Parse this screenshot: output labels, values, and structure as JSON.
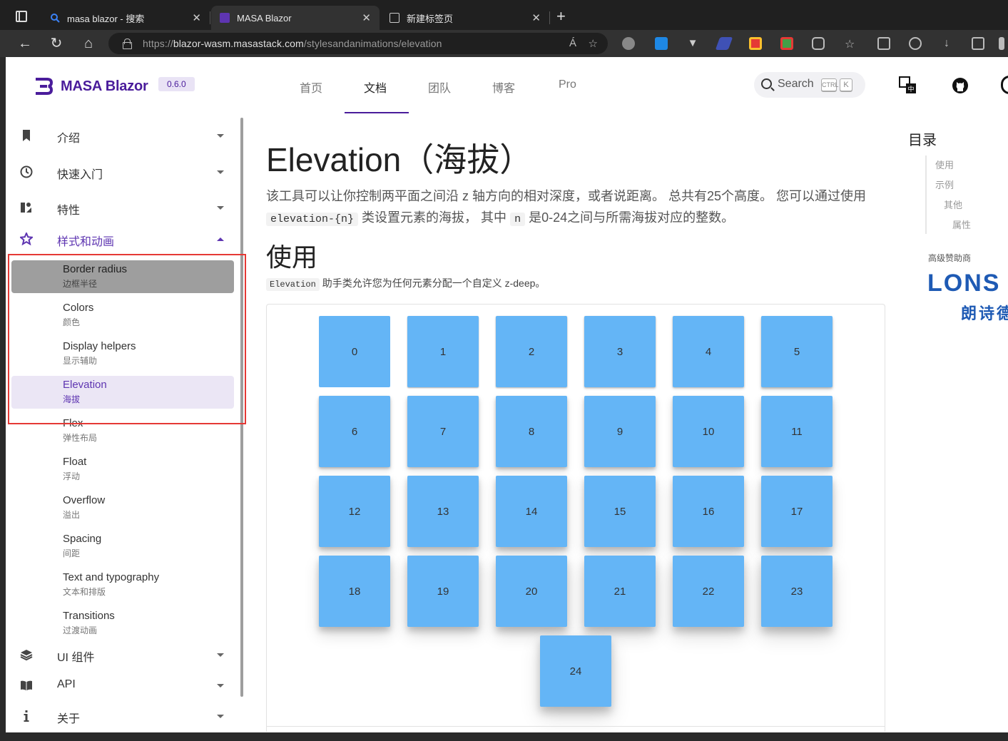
{
  "browser": {
    "tabs": [
      {
        "title": "masa blazor - 搜索",
        "active": false
      },
      {
        "title": "MASA Blazor",
        "active": true
      },
      {
        "title": "新建标签页",
        "active": false
      }
    ],
    "new_tab": "+",
    "url_prefix": "https://",
    "url_host": "blazor-wasm.masastack.com",
    "url_path": "/stylesandanimations/elevation",
    "read_aloud": "Á"
  },
  "header": {
    "brand": "MASA Blazor",
    "version": "0.6.0",
    "nav": [
      "首页",
      "文档",
      "团队",
      "博客",
      "Pro"
    ],
    "active_nav": "文档",
    "search_label": "Search",
    "kbd_ctrl": "CTRL",
    "kbd_k": "K"
  },
  "sidebar": {
    "groups_top": [
      {
        "label": "介绍",
        "icon": "bookmark-icon"
      },
      {
        "label": "快速入门",
        "icon": "clock-icon"
      },
      {
        "label": "特性",
        "icon": "features-icon"
      },
      {
        "label": "样式和动画",
        "icon": "star-icon",
        "open": true
      }
    ],
    "items": [
      {
        "title": "Border radius",
        "subtitle": "边框半径",
        "state": "hover"
      },
      {
        "title": "Colors",
        "subtitle": "颜色",
        "state": ""
      },
      {
        "title": "Display helpers",
        "subtitle": "显示辅助",
        "state": ""
      },
      {
        "title": "Elevation",
        "subtitle": "海拔",
        "state": "active"
      },
      {
        "title": "Flex",
        "subtitle": "弹性布局",
        "state": ""
      },
      {
        "title": "Float",
        "subtitle": "浮动",
        "state": ""
      },
      {
        "title": "Overflow",
        "subtitle": "溢出",
        "state": ""
      },
      {
        "title": "Spacing",
        "subtitle": "间距",
        "state": ""
      },
      {
        "title": "Text and typography",
        "subtitle": "文本和排版",
        "state": ""
      },
      {
        "title": "Transitions",
        "subtitle": "过渡动画",
        "state": ""
      }
    ],
    "groups_bottom": [
      {
        "label": "UI 组件",
        "icon": "layers-icon"
      },
      {
        "label": "API",
        "icon": "book-icon"
      },
      {
        "label": "关于",
        "icon": "info-icon"
      }
    ]
  },
  "main": {
    "title": "Elevation（海拔）",
    "lead_1": "该工具可以让你控制两平面之间沿 z 轴方向的相对深度，或者说距离。 总共有25个高度。 您可以通过使用",
    "lead_code_1": "elevation-{n}",
    "lead_2": "类设置元素的海拔， 其中",
    "lead_code_2": "n",
    "lead_3": "是0-24之间与所需海拔对应的整数。",
    "section_title": "使用",
    "desc_code": "Elevation",
    "desc_text": "助手类允许您为任何元素分配一个自定义 z-deep。",
    "elevations": [
      "0",
      "1",
      "2",
      "3",
      "4",
      "5",
      "6",
      "7",
      "8",
      "9",
      "10",
      "11",
      "12",
      "13",
      "14",
      "15",
      "16",
      "17",
      "18",
      "19",
      "20",
      "21",
      "22",
      "23",
      "24"
    ]
  },
  "toc": {
    "title": "目录",
    "items": [
      "使用",
      "示例",
      "其他",
      "属性"
    ],
    "sponsor_label": "高级赞助商",
    "sponsor_logo": "LONS",
    "sponsor_sub": "朗诗德"
  }
}
